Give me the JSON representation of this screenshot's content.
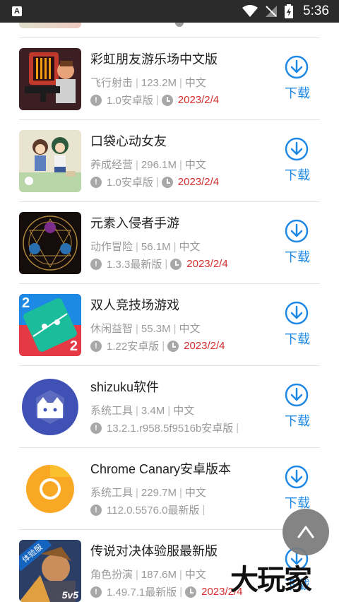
{
  "status_bar": {
    "time": "5:36",
    "app_badge": "A"
  },
  "download_label": "下载",
  "items": [
    {
      "title": "彩虹朋友游乐场中文版",
      "category": "飞行射击",
      "size": "123.2M",
      "language": "中文",
      "version": "1.0安卓版",
      "date": "2023/2/4",
      "thumb": "rainbow-friends-thumbnail"
    },
    {
      "title": "口袋心动女友",
      "category": "养成经营",
      "size": "296.1M",
      "language": "中文",
      "version": "1.0安卓版",
      "date": "2023/2/4",
      "thumb": "pocket-girlfriend-thumbnail"
    },
    {
      "title": "元素入侵者手游",
      "category": "动作冒险",
      "size": "56.1M",
      "language": "中文",
      "version": "1.3.3最新版",
      "date": "2023/2/4",
      "thumb": "element-invader-thumbnail"
    },
    {
      "title": "双人竞技场游戏",
      "category": "休闲益智",
      "size": "55.3M",
      "language": "中文",
      "version": "1.22安卓版",
      "date": "2023/2/4",
      "thumb": "two-player-arena-thumbnail"
    },
    {
      "title": "shizuku软件",
      "category": "系统工具",
      "size": "3.4M",
      "language": "中文",
      "version": "13.2.1.r958.5f9516b安卓版",
      "date": "",
      "thumb": "shizuku-icon"
    },
    {
      "title": "Chrome Canary安卓版本",
      "category": "系统工具",
      "size": "229.7M",
      "language": "中文",
      "version": "112.0.5576.0最新版",
      "date": "",
      "thumb": "chrome-canary-icon"
    },
    {
      "title": "传说对决体验服最新版",
      "category": "角色扮演",
      "size": "187.6M",
      "language": "中文",
      "version": "1.49.7.1最新版",
      "date": "2023/2/4",
      "thumb": "arena-of-valor-thumbnail"
    }
  ],
  "thumb_badges": {
    "arena_left": "2",
    "arena_right": "2",
    "aov_tag": "体验服",
    "aov_logo": "5v5"
  },
  "watermark": "大玩家",
  "colors": {
    "accent": "#1e88e5",
    "date": "#d32f2f"
  }
}
